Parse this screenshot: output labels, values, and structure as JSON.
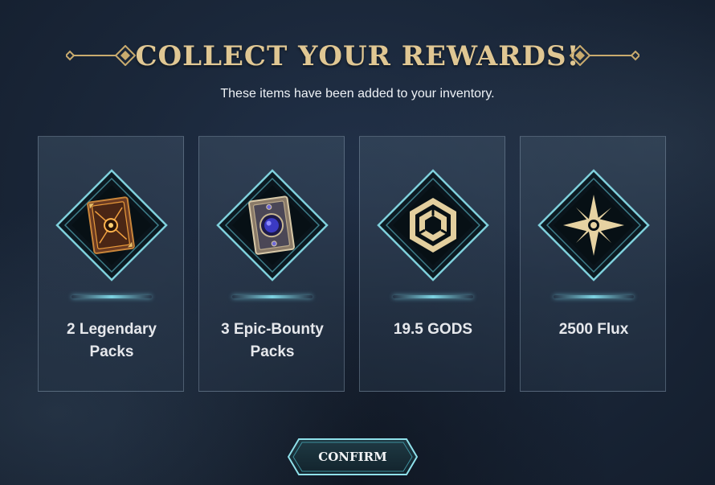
{
  "header": {
    "title": "COLLECT YOUR REWARDS!",
    "subtitle": "These items have been added to your inventory."
  },
  "rewards": [
    {
      "label": "2 Legendary Packs",
      "icon": "legendary-pack-icon"
    },
    {
      "label": "3 Epic-Bounty Packs",
      "icon": "epic-bounty-pack-icon"
    },
    {
      "label": "19.5 GODS",
      "icon": "gods-token-icon"
    },
    {
      "label": "2500 Flux",
      "icon": "flux-star-icon"
    }
  ],
  "confirm_button": {
    "label": "CONFIRM"
  },
  "colors": {
    "gold": "#e0c793",
    "teal_frame": "#7fd0dc",
    "background": "#1b283b"
  }
}
